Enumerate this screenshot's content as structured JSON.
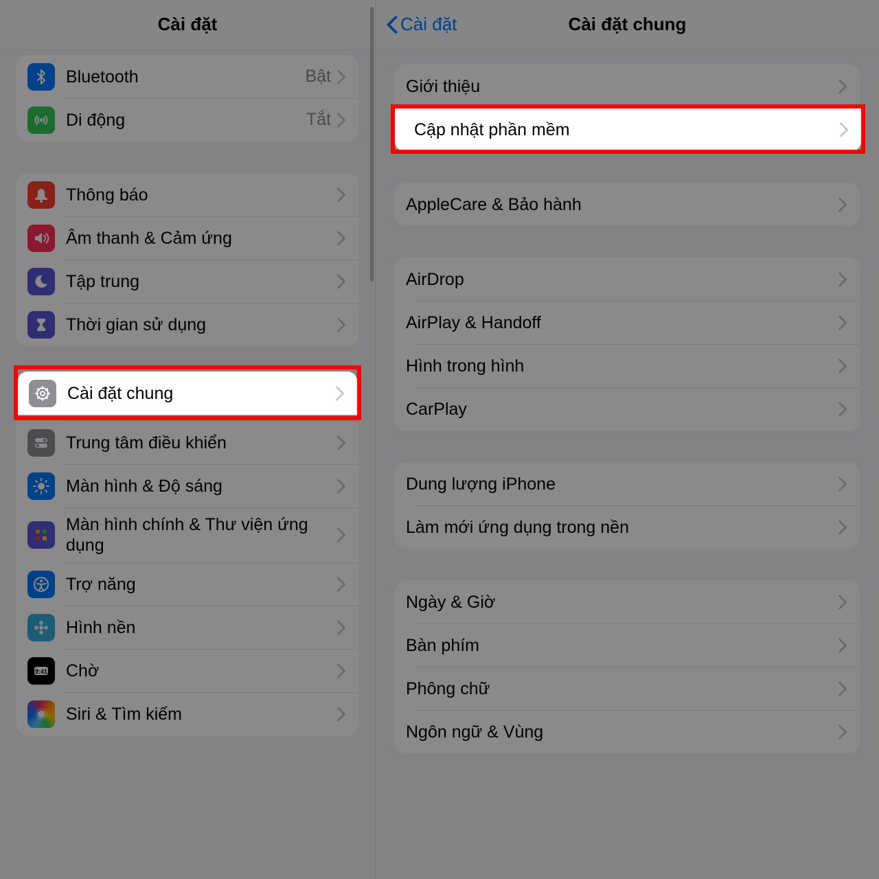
{
  "left": {
    "title": "Cài đặt",
    "groups": [
      {
        "rows": [
          {
            "name": "bluetooth",
            "icon": "bluetooth",
            "iconBg": "bg-blue",
            "label": "Bluetooth",
            "value": "Bật"
          },
          {
            "name": "cellular",
            "icon": "antenna",
            "iconBg": "bg-green",
            "label": "Di động",
            "value": "Tắt"
          }
        ]
      },
      {
        "rows": [
          {
            "name": "notifications",
            "icon": "bell",
            "iconBg": "bg-red",
            "label": "Thông báo"
          },
          {
            "name": "sounds",
            "icon": "speaker",
            "iconBg": "bg-red2",
            "label": "Âm thanh & Cảm ứng"
          },
          {
            "name": "focus",
            "icon": "moon",
            "iconBg": "bg-indigo",
            "label": "Tập trung"
          },
          {
            "name": "screen-time",
            "icon": "hourglass",
            "iconBg": "bg-indigo",
            "label": "Thời gian sử dụng"
          }
        ]
      },
      {
        "rows": [
          {
            "name": "general",
            "icon": "gear",
            "iconBg": "bg-gray",
            "label": "Cài đặt chung",
            "highlighted": true
          },
          {
            "name": "control-center",
            "icon": "switches",
            "iconBg": "bg-gray",
            "label": "Trung tâm điều khiển"
          },
          {
            "name": "display",
            "icon": "sun",
            "iconBg": "bg-blue",
            "label": "Màn hình & Độ sáng"
          },
          {
            "name": "home-screen",
            "icon": "grid",
            "iconBg": "bg-apps",
            "label": "Màn hình chính & Thư viện ứng dụng"
          },
          {
            "name": "accessibility",
            "icon": "access",
            "iconBg": "bg-blue",
            "label": "Trợ năng"
          },
          {
            "name": "wallpaper",
            "icon": "flower",
            "iconBg": "bg-cyan",
            "label": "Hình nền"
          },
          {
            "name": "standby",
            "icon": "clock",
            "iconBg": "bg-black",
            "label": "Chờ"
          },
          {
            "name": "siri",
            "icon": "siri",
            "iconBg": "bg-grad",
            "label": "Siri & Tìm kiếm"
          }
        ]
      }
    ]
  },
  "right": {
    "backLabel": "Cài đặt",
    "title": "Cài đặt chung",
    "groups": [
      {
        "rows": [
          {
            "name": "about",
            "label": "Giới thiệu"
          },
          {
            "name": "software-update",
            "label": "Cập nhật phần mềm",
            "highlighted": true
          }
        ]
      },
      {
        "rows": [
          {
            "name": "applecare",
            "label": "AppleCare & Bảo hành"
          }
        ]
      },
      {
        "rows": [
          {
            "name": "airdrop",
            "label": "AirDrop"
          },
          {
            "name": "airplay",
            "label": "AirPlay & Handoff"
          },
          {
            "name": "pip",
            "label": "Hình trong hình"
          },
          {
            "name": "carplay",
            "label": "CarPlay"
          }
        ]
      },
      {
        "rows": [
          {
            "name": "storage",
            "label": "Dung lượng iPhone"
          },
          {
            "name": "bg-refresh",
            "label": "Làm mới ứng dụng trong nền"
          }
        ]
      },
      {
        "rows": [
          {
            "name": "date-time",
            "label": "Ngày & Giờ"
          },
          {
            "name": "keyboard",
            "label": "Bàn phím"
          },
          {
            "name": "fonts",
            "label": "Phông chữ"
          },
          {
            "name": "language",
            "label": "Ngôn ngữ & Vùng"
          }
        ]
      }
    ]
  },
  "colors": {
    "highlight": "#ff0000",
    "link": "#007aff"
  }
}
